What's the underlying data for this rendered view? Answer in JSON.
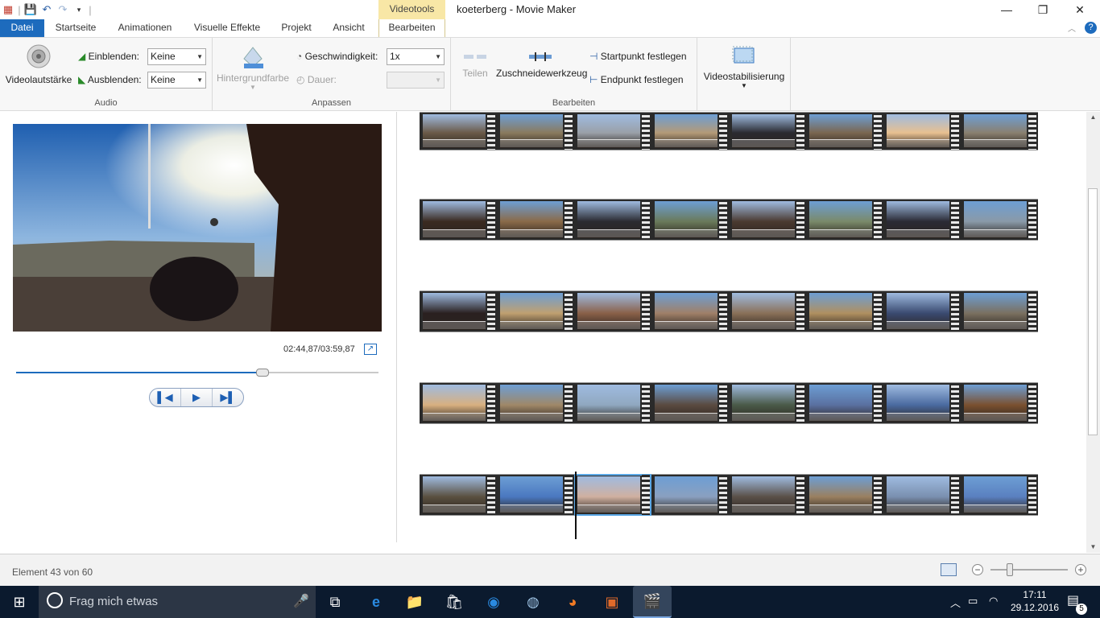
{
  "titlebar": {
    "contextual_tab": "Videotools",
    "window_title": "koeterberg - Movie Maker"
  },
  "tabs": [
    {
      "label": "Datei"
    },
    {
      "label": "Startseite"
    },
    {
      "label": "Animationen"
    },
    {
      "label": "Visuelle Effekte"
    },
    {
      "label": "Projekt"
    },
    {
      "label": "Ansicht"
    },
    {
      "label": "Bearbeiten"
    }
  ],
  "ribbon": {
    "audio": {
      "group_label": "Audio",
      "volume_label": "Videolautstärke",
      "fade_in_label": "Einblenden:",
      "fade_in_value": "Keine",
      "fade_out_label": "Ausblenden:",
      "fade_out_value": "Keine"
    },
    "adjust": {
      "group_label": "Anpassen",
      "background_color_label": "Hintergrundfarbe",
      "speed_label": "Geschwindigkeit:",
      "speed_value": "1x",
      "duration_label": "Dauer:",
      "duration_value": ""
    },
    "edit": {
      "group_label": "Bearbeiten",
      "split_label": "Teilen",
      "trim_label": "Zuschneidewerkzeug",
      "set_start_label": "Startpunkt festlegen",
      "set_end_label": "Endpunkt festlegen"
    },
    "stabilize": {
      "label": "Videostabilisierung"
    }
  },
  "preview": {
    "timecode": "02:44,87/03:59,87",
    "seek_progress": 0.68
  },
  "status": {
    "element_text": "Element 43 von 60",
    "zoom_level": 0.25
  },
  "taskbar": {
    "search_placeholder": "Frag mich etwas",
    "time": "17:11",
    "date": "29.12.2016",
    "notification_count": "5"
  },
  "colors": {
    "file_tab": "#1d6bbd",
    "contextual_tab": "#f8e7a6",
    "taskbar": "#0b1a2e",
    "selection": "#5aa7e6"
  },
  "storyboard": {
    "selected_row": 4,
    "selected_index": 2
  }
}
